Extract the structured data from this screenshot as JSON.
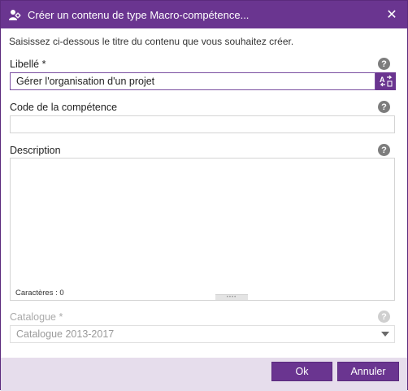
{
  "dialog": {
    "title": "Créer un contenu de type Macro-compétence...",
    "close_symbol": "✕",
    "intro": "Saisissez ci-dessous le titre du contenu que vous souhaitez créer."
  },
  "fields": {
    "libelle": {
      "label": "Libellé *",
      "value": "Gérer l'organisation d'un projet"
    },
    "code": {
      "label": "Code de la compétence",
      "value": ""
    },
    "description": {
      "label": "Description",
      "value": "",
      "counter": "Caractères : 0",
      "resize_grip": "••••"
    },
    "catalogue": {
      "label": "Catalogue *",
      "value": "Catalogue 2013-2017"
    }
  },
  "help_symbol": "?",
  "buttons": {
    "ok": "Ok",
    "cancel": "Annuler"
  },
  "colors": {
    "accent": "#6a3590",
    "footer_bg": "#e6ddec",
    "help_icon": "#7d7d7d"
  },
  "icons": [
    "macro-competence-icon",
    "close-icon",
    "help-icon",
    "translate-icon",
    "chevron-down-icon"
  ]
}
